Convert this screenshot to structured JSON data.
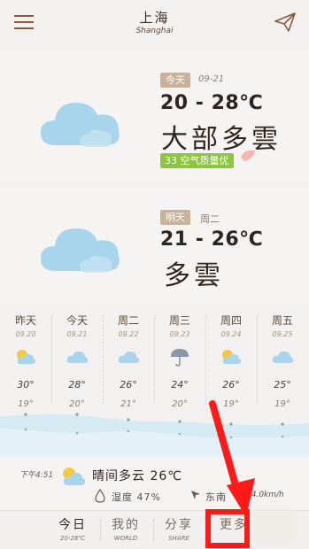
{
  "header": {
    "city": "上海",
    "city_en": "Shanghai"
  },
  "today": {
    "badge": "今天",
    "date": "09-21",
    "temp": "20 - 28℃",
    "condition": "大部多雲",
    "aqi": "33 空气质量优"
  },
  "tomorrow": {
    "badge": "明天",
    "weekday": "周二",
    "temp": "21 - 26℃",
    "condition": "多雲"
  },
  "week": [
    {
      "name": "昨天",
      "date": "09.20",
      "icon": "partly-cloudy-icon",
      "hi": "30°",
      "lo": "19°"
    },
    {
      "name": "今天",
      "date": "09.21",
      "icon": "cloud-icon",
      "hi": "28°",
      "lo": "20°"
    },
    {
      "name": "周二",
      "date": "09.22",
      "icon": "cloud-icon",
      "hi": "26°",
      "lo": "21°"
    },
    {
      "name": "周三",
      "date": "09.23",
      "icon": "umbrella-icon",
      "hi": "24°",
      "lo": "20°"
    },
    {
      "name": "周四",
      "date": "09.24",
      "icon": "partly-cloudy-icon",
      "hi": "26°",
      "lo": "19°"
    },
    {
      "name": "周五",
      "date": "09.25",
      "icon": "cloud-icon",
      "hi": "25°",
      "lo": "19°"
    }
  ],
  "now": {
    "time": "下午4:51",
    "text": "晴间多云 26℃",
    "humidity": "湿度 47%",
    "wind": "东南",
    "wind_speed": "14.0km/h"
  },
  "nav": [
    {
      "label": "今日",
      "sub": "20-28℃"
    },
    {
      "label": "我的",
      "sub": "WORLD"
    },
    {
      "label": "分享",
      "sub": "SHARE"
    },
    {
      "label": "更多",
      "sub": ""
    }
  ],
  "colors": {
    "accent": "#8a5a3c",
    "aqi": "#8cc63f",
    "cloud": "#a8d4ec",
    "arrow": "#ff1a1a"
  }
}
